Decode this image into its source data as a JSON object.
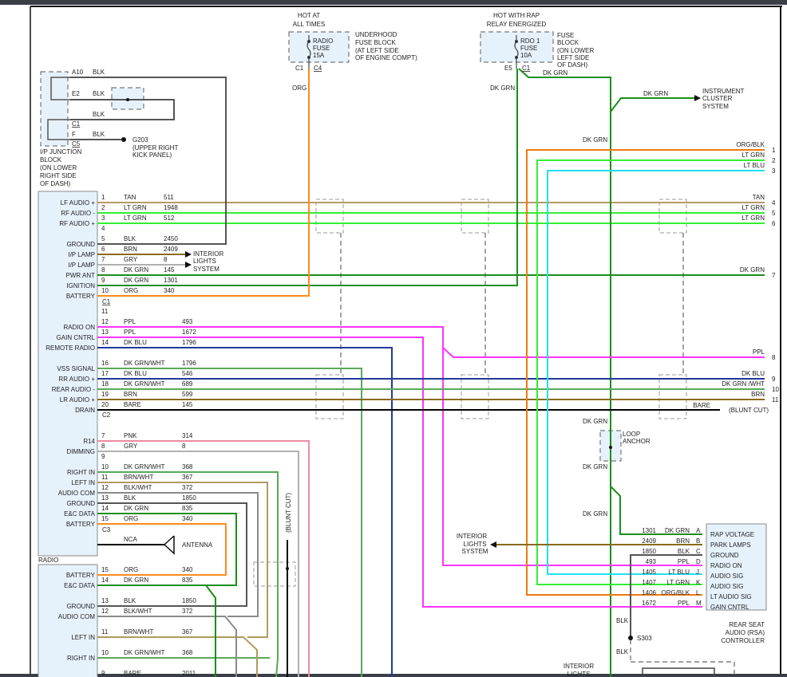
{
  "wire_colors": {
    "TAN": "#b8996a",
    "LT GRN": "#33ee33",
    "BLK": "#555555",
    "BRN": "#8a6a1a",
    "GRY": "#b0b0b0",
    "DK GRN": "#1a8f1a",
    "ORG": "#ff8c1a",
    "PPL": "#ff33ff",
    "DK BLU": "#1f3a9a",
    "DK GRN/WHT": "#5aa85a",
    "BARE": "#000000",
    "PNK": "#f08aa0",
    "BRN/WHT": "#b09a60",
    "BLK/WHT": "#8a8a8a",
    "LT BLU": "#22e0f0",
    "ORG/BLK": "#f07a10"
  },
  "fuses": {
    "underhood": {
      "caption": [
        "HOT AT",
        "ALL TIMES"
      ],
      "fuse": [
        "RADIO",
        "FUSE",
        "15A"
      ],
      "location": [
        "UNDERHOOD",
        "FUSE BLOCK",
        "(AT LEFT SIDE",
        "OF ENGINE COMPT)"
      ],
      "conn_left": "C1",
      "conn_right": "C4",
      "wire": "ORG"
    },
    "dash": {
      "caption": [
        "HOT WITH RAP",
        "RELAY ENERGIZED"
      ],
      "fuse": [
        "RDO 1",
        "FUSE",
        "10A"
      ],
      "location": [
        "FUSE",
        "BLOCK",
        "(ON LOWER",
        "LEFT SIDE",
        "OF DASH)"
      ],
      "conn_left": "E5",
      "conn_right": "C1",
      "wire_a": "DK GRN",
      "wire_b": "DK GRN"
    }
  },
  "junction_block": {
    "pins": [
      "A10",
      "E2",
      "C1",
      "F",
      "C5"
    ],
    "wires": [
      "BLK",
      "BLK",
      "BLK",
      "BLK"
    ],
    "label": [
      "I/P JUNCTION",
      "BLOCK",
      "(ON LOWER",
      "RIGHT SIDE",
      "OF DASH)"
    ],
    "ground": [
      "G203",
      "(UPPER RIGHT",
      "KICK PANEL)"
    ]
  },
  "radio": {
    "label": "RADIO",
    "c1": [
      {
        "pin": "1",
        "wire": "TAN",
        "circuit": "511",
        "func": "LF AUDIO +"
      },
      {
        "pin": "2",
        "wire": "LT GRN",
        "circuit": "1948",
        "func": "RF AUDIO -"
      },
      {
        "pin": "3",
        "wire": "LT GRN",
        "circuit": "512",
        "func": "RF AUDIO +"
      },
      {
        "pin": "4",
        "wire": "",
        "circuit": "",
        "func": ""
      },
      {
        "pin": "5",
        "wire": "BLK",
        "circuit": "2450",
        "func": "GROUND"
      },
      {
        "pin": "6",
        "wire": "BRN",
        "circuit": "2409",
        "func": "I/P LAMP"
      },
      {
        "pin": "7",
        "wire": "GRY",
        "circuit": "8",
        "func": "I/P LAMP"
      },
      {
        "pin": "8",
        "wire": "DK GRN",
        "circuit": "145",
        "func": "PWR ANT"
      },
      {
        "pin": "9",
        "wire": "DK GRN",
        "circuit": "1301",
        "func": "IGNITION"
      },
      {
        "pin": "10",
        "wire": "ORG",
        "circuit": "340",
        "func": "BATTERY"
      }
    ],
    "c1_label": "C1",
    "c2": [
      {
        "pin": "11",
        "wire": "",
        "circuit": "",
        "func": ""
      },
      {
        "pin": "12",
        "wire": "PPL",
        "circuit": "493",
        "func": "RADIO ON"
      },
      {
        "pin": "13",
        "wire": "PPL",
        "circuit": "1672",
        "func": "GAIN CNTRL"
      },
      {
        "pin": "14",
        "wire": "DK BLU",
        "circuit": "1796",
        "func": "REMOTE RADIO"
      },
      {
        "pin": "16",
        "wire": "DK GRN/WHT",
        "circuit": "1796",
        "func": "VSS SIGNAL"
      },
      {
        "pin": "17",
        "wire": "DK BLU",
        "circuit": "546",
        "func": "RR AUDIO +"
      },
      {
        "pin": "18",
        "wire": "DK GRN/WHT",
        "circuit": "689",
        "func": "REAR AUDIO -"
      },
      {
        "pin": "19",
        "wire": "BRN",
        "circuit": "599",
        "func": "LR AUDIO +"
      },
      {
        "pin": "20",
        "wire": "BARE",
        "circuit": "145",
        "func": "DRAIN"
      }
    ],
    "c2_label": "C2",
    "c3": [
      {
        "pin": "7",
        "wire": "PNK",
        "circuit": "314",
        "func": "R14"
      },
      {
        "pin": "8",
        "wire": "GRY",
        "circuit": "8",
        "func": "DIMMING"
      },
      {
        "pin": "9",
        "wire": "",
        "circuit": "",
        "func": ""
      },
      {
        "pin": "10",
        "wire": "DK GRN/WHT",
        "circuit": "368",
        "func": "RIGHT IN"
      },
      {
        "pin": "11",
        "wire": "BRN/WHT",
        "circuit": "367",
        "func": "LEFT IN"
      },
      {
        "pin": "12",
        "wire": "BLK/WHT",
        "circuit": "372",
        "func": "AUDIO COM"
      },
      {
        "pin": "13",
        "wire": "BLK",
        "circuit": "1850",
        "func": "GROUND"
      },
      {
        "pin": "14",
        "wire": "DK GRN",
        "circuit": "835",
        "func": "E&C DATA"
      },
      {
        "pin": "15",
        "wire": "ORG",
        "circuit": "340",
        "func": "BATTERY"
      }
    ],
    "c3_label": "C3",
    "antenna": {
      "wire": "NCA",
      "label": "ANTENNA"
    },
    "lower": [
      {
        "pin": "15",
        "wire": "ORG",
        "circuit": "340",
        "func": "BATTERY"
      },
      {
        "pin": "14",
        "wire": "DK GRN",
        "circuit": "835",
        "func": "E&C DATA"
      },
      {
        "pin": "13",
        "wire": "BLK",
        "circuit": "1850",
        "func": "GROUND"
      },
      {
        "pin": "12",
        "wire": "BLK/WHT",
        "circuit": "372",
        "func": "AUDIO COM"
      },
      {
        "pin": "11",
        "wire": "BRN/WHT",
        "circuit": "367",
        "func": "LEFT IN"
      },
      {
        "pin": "10",
        "wire": "DK GRN/WHT",
        "circuit": "368",
        "func": "RIGHT IN"
      },
      {
        "pin": "9",
        "wire": "BARE",
        "circuit": "2011",
        "func": ""
      }
    ]
  },
  "right_edge": [
    {
      "wire": "ORG/BLK",
      "num": "1"
    },
    {
      "wire": "LT GRN",
      "num": "2"
    },
    {
      "wire": "LT BLU",
      "num": "3"
    },
    {
      "wire": "TAN",
      "num": "4"
    },
    {
      "wire": "LT GRN",
      "num": "5"
    },
    {
      "wire": "LT GRN",
      "num": "6"
    },
    {
      "wire": "DK GRN",
      "num": "7"
    },
    {
      "wire": "PPL",
      "num": "8"
    },
    {
      "wire": "DK BLU",
      "num": "9"
    },
    {
      "wire": "DK GRN /WHT",
      "num": "10"
    },
    {
      "wire": "BRN",
      "num": "11"
    }
  ],
  "bare_label": "BARE",
  "blunt_cut": "(BLUNT CUT)",
  "interior_lights": [
    "INTERIOR",
    "LIGHTS",
    "SYSTEM"
  ],
  "instrument_cluster": [
    "INSTRUMENT",
    "CLUSTER",
    "SYSTEM"
  ],
  "trunk_labels": [
    "DK GRN",
    "DK GRN",
    "DK GRN",
    "DK GRN",
    "DK GRN"
  ],
  "loop_anchor": [
    "LOOP",
    "ANCHOR"
  ],
  "rsa": {
    "pins": [
      {
        "circuit": "1301",
        "wire": "DK GRN",
        "pin": "A",
        "func": "RAP VOLTAGE"
      },
      {
        "circuit": "2409",
        "wire": "BRN",
        "pin": "B",
        "func": "PARK LAMPS"
      },
      {
        "circuit": "1850",
        "wire": "BLK",
        "pin": "C",
        "func": "GROUND"
      },
      {
        "circuit": "493",
        "wire": "PPL",
        "pin": "D",
        "func": "RADIO ON"
      },
      {
        "circuit": "1405",
        "wire": "LT BLU",
        "pin": "J",
        "func": "AUDIO SIG"
      },
      {
        "circuit": "1407",
        "wire": "LT GRN",
        "pin": "K",
        "func": "AUDIO SIG"
      },
      {
        "circuit": "1406",
        "wire": "ORG/BLK",
        "pin": "L",
        "func": "LT AUDIO SIG"
      },
      {
        "circuit": "1672",
        "wire": "PPL",
        "pin": "M",
        "func": "GAIN CNTRL"
      }
    ],
    "label": [
      "REAR SEAT",
      "AUDIO (RSA)",
      "CONTROLLER"
    ],
    "ground_wire_a": "BLK",
    "splice": "S303",
    "ground_wire_b": "BLK",
    "bottom_label": [
      "INTERIOR",
      "LIGHTS"
    ]
  }
}
